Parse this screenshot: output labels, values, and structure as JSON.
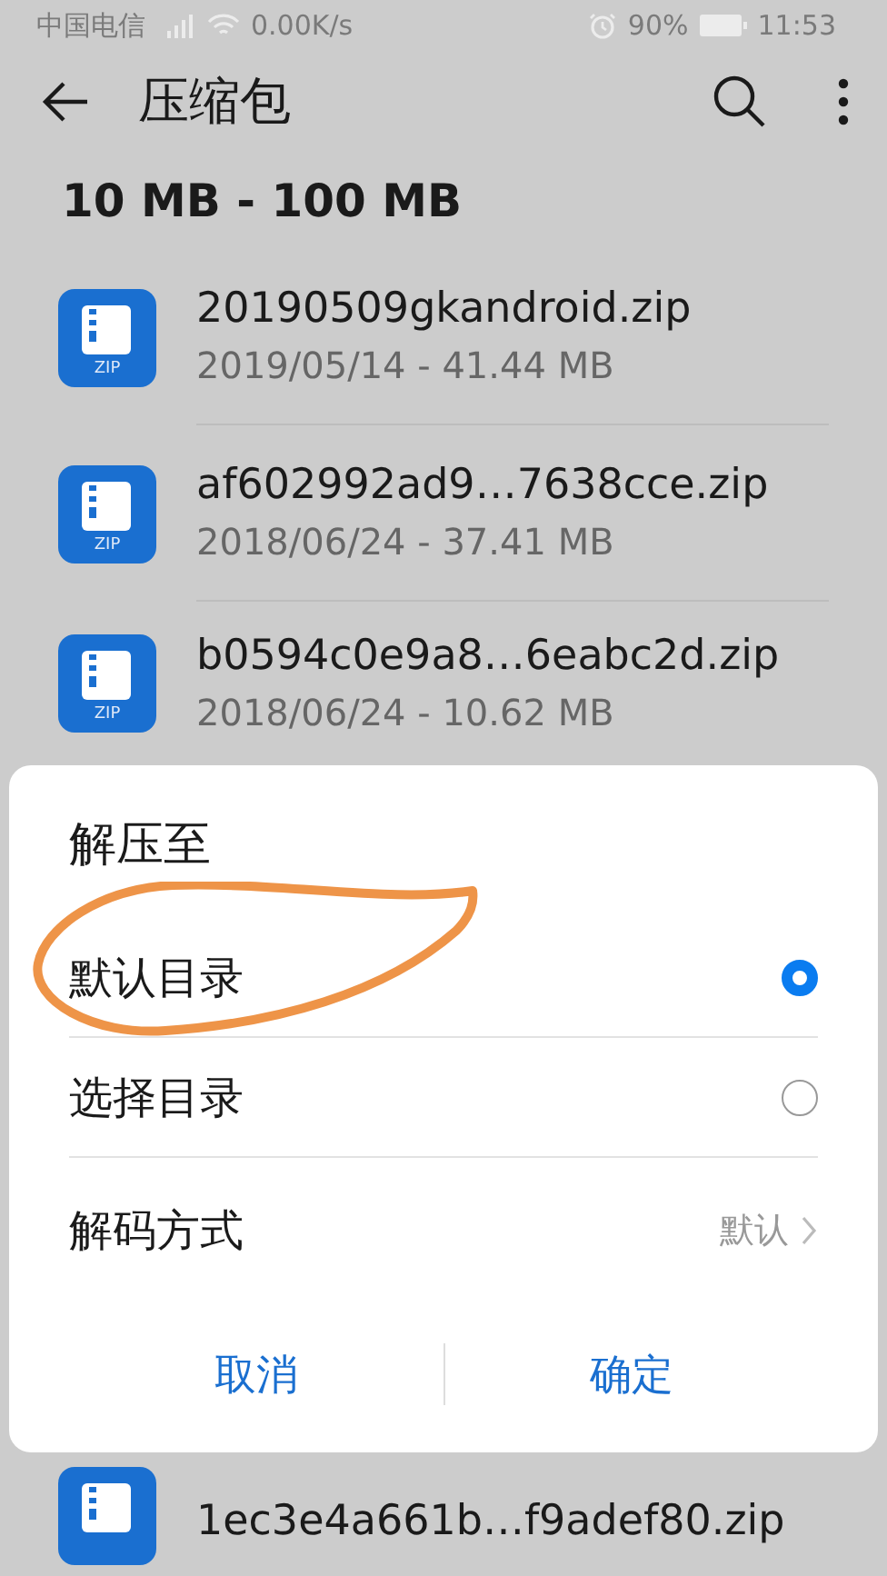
{
  "status_bar": {
    "carrier": "中国电信",
    "speed": "0.00K/s",
    "battery": "90%",
    "time": "11:53"
  },
  "app_bar": {
    "title": "压缩包"
  },
  "section": {
    "title": "10 MB - 100 MB"
  },
  "files": [
    {
      "name": "20190509gkandroid.zip",
      "meta": "2019/05/14 - 41.44 MB",
      "icon_label": "ZIP"
    },
    {
      "name": "af602992ad9…7638cce.zip",
      "meta": "2018/06/24 - 37.41 MB",
      "icon_label": "ZIP"
    },
    {
      "name": "b0594c0e9a8…6eabc2d.zip",
      "meta": "2018/06/24 - 10.62 MB",
      "icon_label": "ZIP"
    }
  ],
  "dialog": {
    "title": "解压至",
    "options": [
      {
        "label": "默认目录",
        "selected": true
      },
      {
        "label": "选择目录",
        "selected": false
      }
    ],
    "decode": {
      "label": "解码方式",
      "value": "默认"
    },
    "buttons": [
      "取消",
      "确定"
    ]
  },
  "files_below": [
    {
      "name": "1ec3e4a661b…f9adef80.zip"
    }
  ]
}
